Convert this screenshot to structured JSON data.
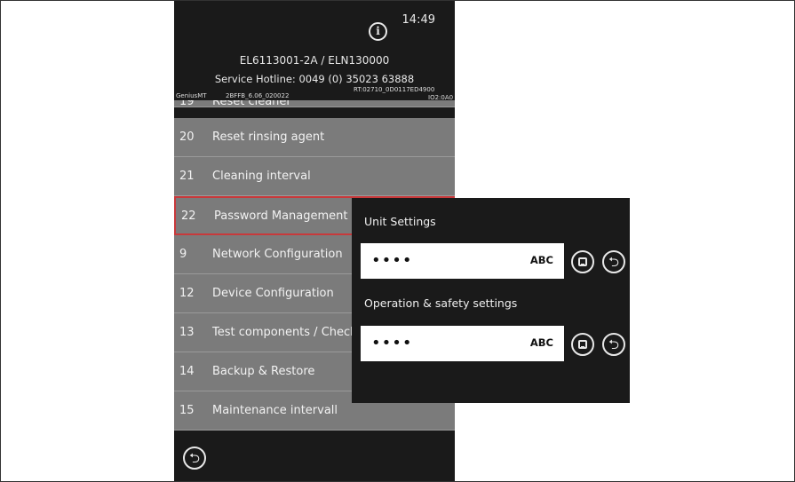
{
  "header": {
    "time": "14:49",
    "model": "EL6113001-2A / ELN130000",
    "hotline": "Service Hotline: 0049 (0) 35023 63888",
    "sw_left": "GeniusMT",
    "sw_center": "2BFFB_6.06_020022",
    "sw_right_1": "RT:02710_0D0117ED4900",
    "sw_right_2": "IO2:0A0"
  },
  "menu": {
    "items": [
      {
        "num": "19",
        "label": "Reset cleaner"
      },
      {
        "num": "20",
        "label": "Reset rinsing agent"
      },
      {
        "num": "21",
        "label": "Cleaning interval"
      },
      {
        "num": "22",
        "label": "Password Management"
      },
      {
        "num": "9",
        "label": "Network Configuration"
      },
      {
        "num": "12",
        "label": "Device Configuration"
      },
      {
        "num": "13",
        "label": "Test components / Check"
      },
      {
        "num": "14",
        "label": "Backup & Restore"
      },
      {
        "num": "15",
        "label": "Maintenance intervall"
      }
    ],
    "selected_index": 3
  },
  "popup": {
    "unit_settings_title": "Unit Settings",
    "unit_password": "••••",
    "unit_mode": "ABC",
    "operation_title": "Operation & safety settings",
    "operation_password": "••••",
    "operation_mode": "ABC"
  },
  "colors": {
    "selected_border": "#c8393b",
    "row_bg": "#7b7b7b",
    "panel_bg": "#1a1a1a"
  },
  "icons": {
    "info": "info-icon",
    "back": "back-icon",
    "save": "save-icon"
  }
}
